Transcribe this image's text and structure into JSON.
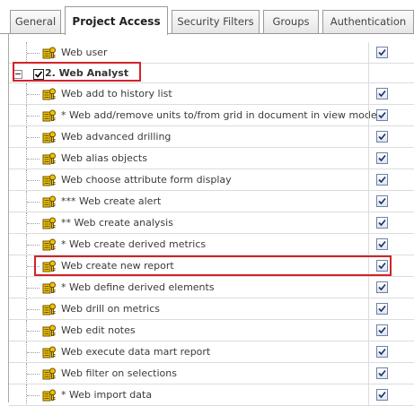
{
  "tabs": [
    {
      "label": "General",
      "active": false
    },
    {
      "label": "Project Access",
      "active": true
    },
    {
      "label": "Security Filters",
      "active": false
    },
    {
      "label": "Groups",
      "active": false
    },
    {
      "label": "Authentication",
      "active": false
    }
  ],
  "privileges": {
    "top_item": {
      "label": "Web user",
      "granted": true
    },
    "group": {
      "label": "2. Web Analyst",
      "checked": true,
      "expanded": true
    },
    "items": [
      {
        "label": "Web add to history list",
        "granted": true
      },
      {
        "label": "* Web add/remove units to/from grid in document in view mode",
        "granted": true
      },
      {
        "label": "Web advanced drilling",
        "granted": true
      },
      {
        "label": "Web alias objects",
        "granted": true
      },
      {
        "label": "Web choose attribute form display",
        "granted": true
      },
      {
        "label": "*** Web create alert",
        "granted": true
      },
      {
        "label": "** Web create analysis",
        "granted": true
      },
      {
        "label": "* Web create derived metrics",
        "granted": true
      },
      {
        "label": "Web create new report",
        "granted": true
      },
      {
        "label": "* Web define derived elements",
        "granted": true
      },
      {
        "label": "Web drill on metrics",
        "granted": true
      },
      {
        "label": "Web edit notes",
        "granted": true
      },
      {
        "label": "Web execute data mart report",
        "granted": true
      },
      {
        "label": "Web filter on selections",
        "granted": true
      },
      {
        "label": "* Web import data",
        "granted": true
      }
    ]
  },
  "icons": {
    "privilege": "privilege-key-icon",
    "granted": "checkmark-icon",
    "expander": "collapse-minus-icon"
  },
  "colors": {
    "highlight": "#d2232a",
    "icon_yellow": "#f2c200",
    "checkbox_border": "#6b82a8",
    "grid_line": "#dcdcdc"
  }
}
